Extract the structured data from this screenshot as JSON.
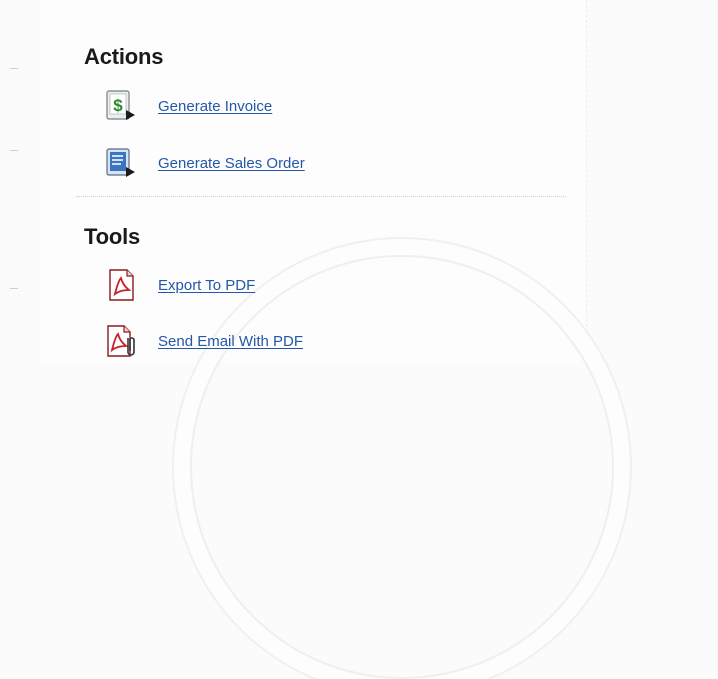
{
  "actions": {
    "title": "Actions",
    "items": [
      {
        "label": "Generate Invoice",
        "icon": "invoice-icon"
      },
      {
        "label": "Generate Sales Order",
        "icon": "sales-order-icon"
      }
    ]
  },
  "tools": {
    "title": "Tools",
    "items": [
      {
        "label": "Export To PDF",
        "icon": "pdf-icon"
      },
      {
        "label": "Send Email With PDF",
        "icon": "pdf-email-icon"
      }
    ]
  },
  "colors": {
    "link": "#2457a8",
    "heading": "#1a1a1a",
    "pdf_red": "#c8202a",
    "invoice_green": "#2f8a2f"
  }
}
